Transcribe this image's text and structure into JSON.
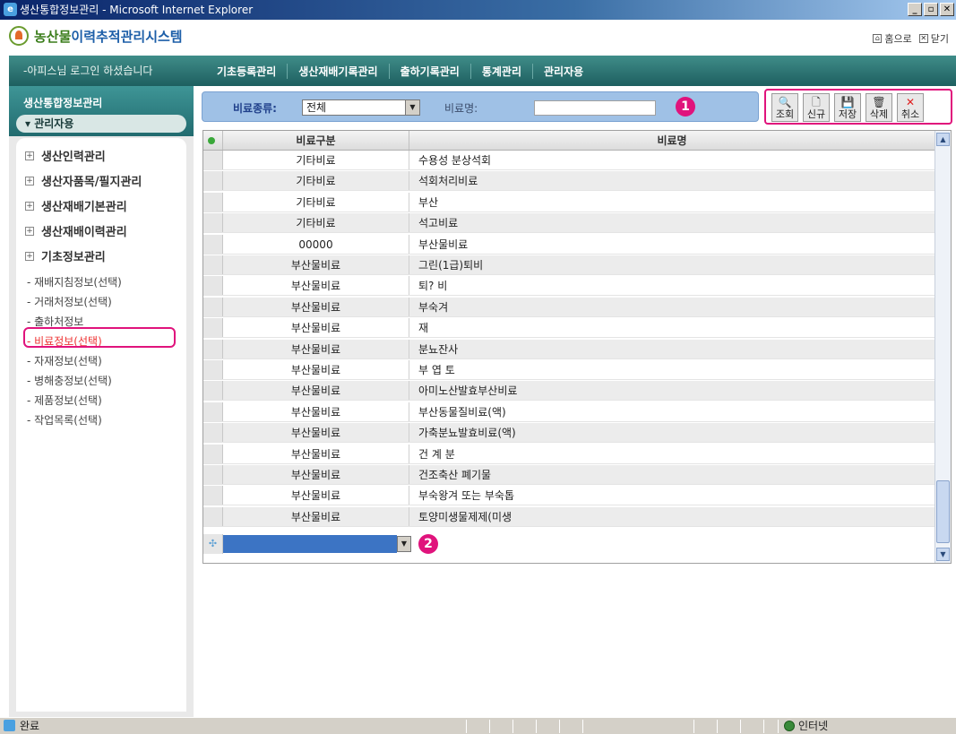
{
  "window": {
    "title": "생산통합정보관리 - Microsoft Internet Explorer",
    "buttons": [
      "_",
      "▫",
      "✕"
    ]
  },
  "app": {
    "logo_main": "농산물",
    "logo_accent": "이력추적관리시스템",
    "home_link": "홈으로",
    "close_link": "닫기"
  },
  "nav": {
    "login_text": "-아피스님 로그인 하셨습니다",
    "menu": [
      "기초등록관리",
      "생산재배기록관리",
      "출하기록관리",
      "통계관리",
      "관리자용"
    ]
  },
  "sidebar": {
    "title": "생산통합정보관리",
    "section": "관리자용",
    "tree": [
      "생산인력관리",
      "생산자품목/필지관리",
      "생산재배기본관리",
      "생산재배이력관리",
      "기초정보관리"
    ],
    "sub_items": [
      "- 재배지침정보(선택)",
      "- 거래처정보(선택)",
      "- 출하처정보",
      "- 비료정보(선택)",
      "- 자재정보(선택)",
      "- 병해충정보(선택)",
      "- 제품정보(선택)",
      "- 작업목록(선택)"
    ],
    "active_index": 3
  },
  "search": {
    "type_label": "비료종류:",
    "type_value": "전체",
    "name_label": "비료명:",
    "name_value": ""
  },
  "badges": {
    "one": "1",
    "two": "2"
  },
  "toolbar": {
    "buttons": [
      {
        "icon": "magnifier-icon",
        "glyph": "🔍",
        "label": "조회"
      },
      {
        "icon": "new-doc-icon",
        "glyph": "🗋",
        "label": "신규"
      },
      {
        "icon": "save-icon",
        "glyph": "💾",
        "label": "저장"
      },
      {
        "icon": "trash-icon",
        "glyph": "🗑",
        "label": "삭제"
      },
      {
        "icon": "cancel-icon",
        "glyph": "✕",
        "label": "취소"
      }
    ]
  },
  "grid": {
    "headers": [
      "비료구분",
      "비료명"
    ],
    "rows": [
      [
        "기타비료",
        "수용성 분상석회"
      ],
      [
        "기타비료",
        "석회처리비료"
      ],
      [
        "기타비료",
        "부산"
      ],
      [
        "기타비료",
        "석고비료"
      ],
      [
        "00000",
        "부산물비료"
      ],
      [
        "부산물비료",
        "그린(1급)퇴비"
      ],
      [
        "부산물비료",
        "퇴? 비"
      ],
      [
        "부산물비료",
        "부숙겨"
      ],
      [
        "부산물비료",
        "재"
      ],
      [
        "부산물비료",
        "분뇨잔사"
      ],
      [
        "부산물비료",
        "부 엽 토"
      ],
      [
        "부산물비료",
        "아미노산발효부산비료"
      ],
      [
        "부산물비료",
        "부산동물질비료(액)"
      ],
      [
        "부산물비료",
        "가축분뇨발효비료(액)"
      ],
      [
        "부산물비료",
        "건 계 분"
      ],
      [
        "부산물비료",
        "건조축산 폐기물"
      ],
      [
        "부산물비료",
        "부숙왕겨 또는 부숙톱"
      ],
      [
        "부산물비료",
        "토양미생물제제(미생"
      ]
    ]
  },
  "status": {
    "text": "완료",
    "zone": "인터넷"
  }
}
